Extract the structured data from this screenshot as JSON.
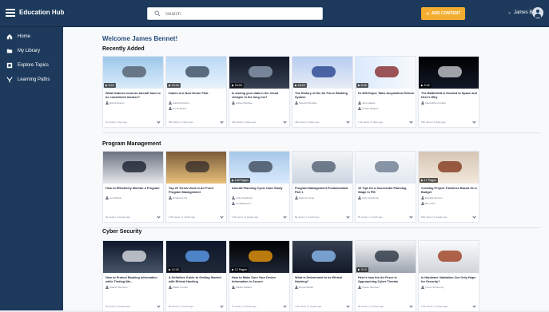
{
  "app": {
    "title": "Education Hub"
  },
  "search": {
    "placeholder": "Search"
  },
  "top": {
    "add_content": "ADD CONTENT",
    "user_name": "James B."
  },
  "nav": [
    {
      "label": "Home",
      "icon": "home-icon"
    },
    {
      "label": "My Library",
      "icon": "library-icon"
    },
    {
      "label": "Explore Topics",
      "icon": "topics-icon"
    },
    {
      "label": "Learning Paths",
      "icon": "paths-icon"
    }
  ],
  "main": {
    "welcome": "Welcome James Bennet!"
  },
  "sections": [
    {
      "title": "Recently Added",
      "cards": [
        {
          "title": "What features must an aircraft have to be considered modern?",
          "badge": "6:24",
          "author": "David Newton",
          "author2": "",
          "meta": "1k views | 1 day ago"
        },
        {
          "title": "Duties of a New Drone Pilot",
          "badge": "10:16",
          "author": "Sandra Roberts",
          "author2": "Drone Board",
          "meta": "560 views | 3 days ago"
        },
        {
          "title": "Is storing your data in the Cloud cheaper in the long run?",
          "badge": "16:03",
          "author": "Adrian McGhee",
          "author2": "",
          "meta": "230 views | 3 days ago"
        },
        {
          "title": "The History of the Air Force Ranking System",
          "badge": "26:24",
          "author": "Sandra Partridge",
          "author2": "",
          "meta": "400 views | 4 days ago"
        },
        {
          "title": "Dr Will Roper Talks Acquisition Reform",
          "badge": "8:45",
          "author": "John Haskel",
          "author2": "Arman Maguire",
          "meta": "1.4k views | 5 days ago"
        },
        {
          "title": "The Battlefield is Headed to Space and Here's Why",
          "badge": "5:32",
          "author": "Samantha Crockett",
          "author2": "",
          "meta": "620 views | 6 days ago"
        }
      ]
    },
    {
      "title": "Program Management",
      "cards": [
        {
          "title": "How to Effectively Monitor a Program",
          "badge": "",
          "author": "Lori Patrick",
          "author2": "",
          "meta": "4k views | 3 weeks ago"
        },
        {
          "title": "Top 20 Terms Used in Air Force Program Management",
          "badge": "",
          "author": "Ronald Ferrel",
          "author2": "",
          "meta": "2.5k views | 1 month ago"
        },
        {
          "title": "Aircraft Planning Cycle Case Study",
          "badge": "145 Pages",
          "author": "Andy Davidman",
          "author2": "Ari Williamson",
          "meta": "1.8k views | 3 weeks ago"
        },
        {
          "title": "Program Management Fundamentals Part 1",
          "badge": "",
          "author": "Patricia Young",
          "author2": "",
          "meta": "8k views | 1 month ago"
        },
        {
          "title": "10 Tips for a Successful Planning Stage in PM",
          "badge": "",
          "author": "Andy Davidman",
          "author2": "",
          "meta": "5k views | 1 month ago"
        },
        {
          "title": "Creating Project Timelines Based On a Budget",
          "badge": "17 Pages",
          "author": "Edward Harmon",
          "author2": "Ben Fitch",
          "meta": "925 views | 4 weeks ago"
        }
      ]
    },
    {
      "title": "Cyber Security",
      "cards": [
        {
          "title": "How to Protect Banking Information while Tinding Wa...",
          "badge": "",
          "author": "Stanley Morrison",
          "author2": "",
          "meta": "4k views | 3 weeks ago"
        },
        {
          "title": "A Definitive Guide to Getting Started with Ethical Hacking",
          "badge": "12:43",
          "author": "Walter Condor",
          "author2": "",
          "meta": "3k views | 1 month ago"
        },
        {
          "title": "How to Make Sure Your Device Information is Secure",
          "badge": "12 Pages",
          "author": "William Ballard",
          "author2": "",
          "meta": "7k views | 2 weeks ago"
        },
        {
          "title": "What is Determined to be Ethical Hacking?",
          "badge": "",
          "author": "Denzel Booth",
          "author2": "",
          "meta": "4.5k views | 3 weeks ago"
        },
        {
          "title": "Here's how the Air Force is Approaching Cyber Threats",
          "badge": "3:13",
          "author": "Kristen Morrison",
          "author2": "",
          "meta": "3k views | 3 months ago"
        },
        {
          "title": "Is Hardware Validation Our Only Hope for Security?",
          "badge": "",
          "author": "Trevor Armstrong",
          "author2": "",
          "meta": "2.5k views | 2 weeks ago"
        }
      ]
    }
  ],
  "colors": {
    "topbar": "#1d3a5c",
    "accent": "#f4ae2f",
    "background": "#e9ecf1"
  }
}
